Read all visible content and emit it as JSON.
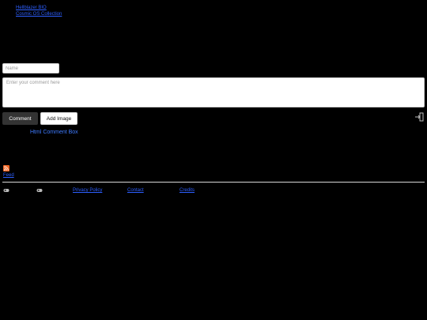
{
  "top_links": [
    "Hellblazer BIO",
    "Cosmic OS Collection"
  ],
  "form": {
    "name_placeholder": "Name",
    "comment_placeholder": "Enter your comment here",
    "comment_button": "Comment",
    "add_image_button": "Add Image"
  },
  "powered_by": "Html Comment Box",
  "rss_label": "Feed",
  "footer_links": [
    "Privacy Policy",
    "Contact",
    "Credits"
  ],
  "colors": {
    "background": "#000000",
    "link": "#2d5fff",
    "rss": "#f26522",
    "button_dark": "#333333"
  }
}
